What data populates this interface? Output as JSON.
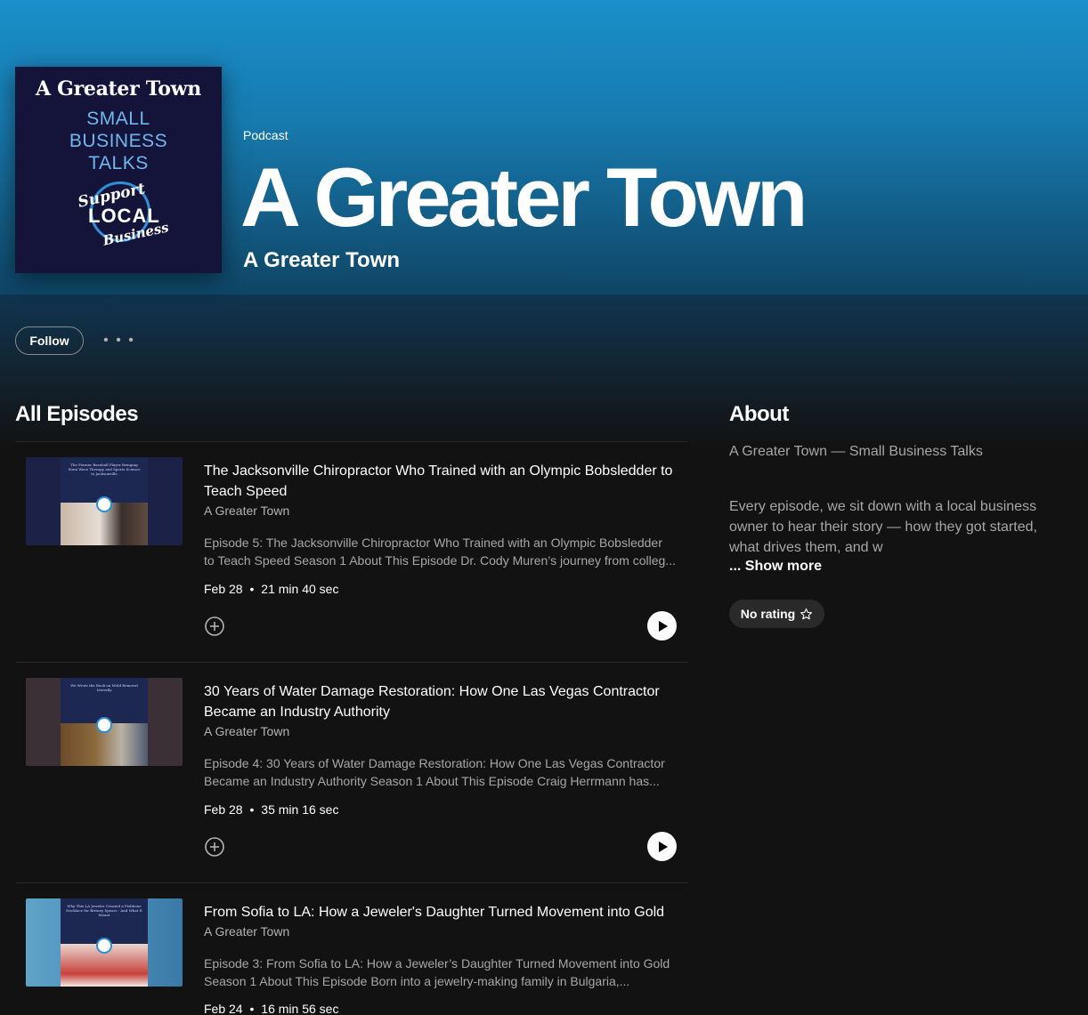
{
  "podcast": {
    "cover": {
      "title": "A Greater Town",
      "subtitle_lines": [
        "SMALL",
        "BUSINESS",
        "TALKS"
      ],
      "badge": [
        "Support",
        "LOCAL",
        "Business"
      ]
    },
    "kind": "Podcast",
    "title": "A Greater Town",
    "author": "A Greater Town"
  },
  "actions": {
    "follow_label": "Follow",
    "more_label": "• • •"
  },
  "episodes_section": {
    "title": "All Episodes",
    "items": [
      {
        "title": "The Jacksonville Chiropractor Who Trained with an Olympic Bobsledder to Teach Speed",
        "author": "A Greater Town",
        "description": "Episode 5: The Jacksonville Chiropractor Who Trained with an Olympic Bobsledder to Teach Speed Season 1 About This Episode Dr. Cody Muren’s journey from colleg...",
        "date": "Feb 28",
        "duration": "21 min 40 sec",
        "thumb_caption": "The Former Baseball Player Bringing Stem Wave Therapy and Sports Science to Jacksonville"
      },
      {
        "title": "30 Years of Water Damage Restoration: How One Las Vegas Contractor Became an Industry Authority",
        "author": "A Greater Town",
        "description": "Episode 4: 30 Years of Water Damage Restoration: How One Las Vegas Contractor Became an Industry Authority Season 1 About This Episode Craig Herrmann has...",
        "date": "Feb 28",
        "duration": "35 min 16 sec",
        "thumb_caption": "We Wrote the Book on Mold Removal Literally"
      },
      {
        "title": "From Sofia to LA: How a Jeweler's Daughter Turned Movement into Gold",
        "author": "A Greater Town",
        "description": "Episode 3: From Sofia to LA: How a Jeweler’s Daughter Turned Movement into Gold Season 1 About This Episode Born into a jewelry-making family in Bulgaria,...",
        "date": "Feb 24",
        "duration": "16 min 56 sec",
        "thumb_caption": "Why This LA Jeweler Created a Fishbone Necklace for Britney Spears - And What It Meant"
      }
    ]
  },
  "about": {
    "title": "About",
    "tagline": "A Greater Town — Small Business Talks",
    "description": "Every episode, we sit down with a local business owner to hear their story — how they got started, what drives them, and w",
    "show_more_label": "... Show more",
    "rating_label": "No rating"
  },
  "colors": {
    "hero_top": "#1a8fc9",
    "hero_bottom": "#0f4566",
    "background": "#121212",
    "cover_bg": "#14143a",
    "cover_accent": "#6fb7ec"
  }
}
